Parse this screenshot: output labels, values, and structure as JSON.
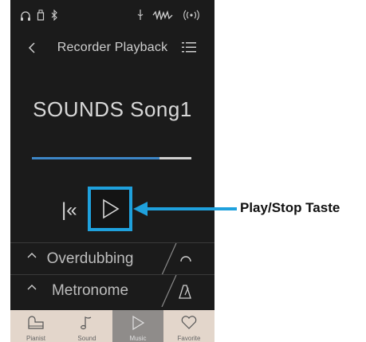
{
  "header": {
    "title": "Recorder Playback"
  },
  "song": {
    "title": "SOUNDS Song1",
    "progress": 0.8
  },
  "rows": {
    "overdubbing": "Overdubbing",
    "metronome": "Metronome"
  },
  "tabs": [
    {
      "label": "Pianist",
      "icon": "piano-icon"
    },
    {
      "label": "Sound",
      "icon": "music-note-icon"
    },
    {
      "label": "Music",
      "icon": "play-icon"
    },
    {
      "label": "Favorite",
      "icon": "heart-icon"
    }
  ],
  "active_tab": "Music",
  "callout": {
    "label": "Play/Stop Taste"
  },
  "colors": {
    "accent": "#1fa1dd",
    "progress": "#3d86c6",
    "tabbar": "#e3d6cb",
    "screen": "#1b1b1b"
  }
}
